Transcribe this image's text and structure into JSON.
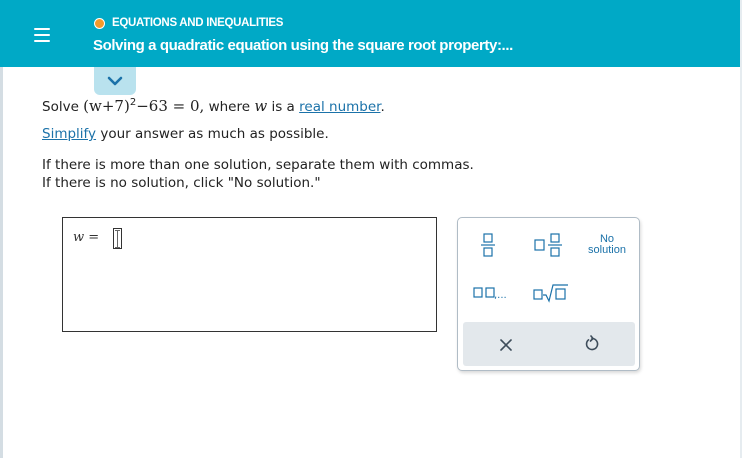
{
  "header": {
    "topic": "EQUATIONS AND INEQUALITIES",
    "title": "Solving a quadratic equation using the square root property:..."
  },
  "problem": {
    "solve_word": "Solve",
    "eq_lhs": "(w+7)",
    "eq_exp": "2",
    "eq_rhs": "−63 = 0,",
    "where_text": "where",
    "var": "w",
    "is_a": "is a",
    "real_number_link": "real number",
    "period": ".",
    "simplify_link": "Simplify",
    "simplify_rest": " your answer as much as possible.",
    "instruction_1": "If there is more than one solution, separate them with commas.",
    "instruction_2": "If there is no solution, click \"No solution.\""
  },
  "answer": {
    "variable": "w",
    "equals": "=",
    "value": ""
  },
  "keypad": {
    "no_solution_line1": "No",
    "no_solution_line2": "solution",
    "list_key_dots": ",..."
  },
  "colors": {
    "header": "#00a9c6",
    "accent_dot": "#f39a2b",
    "link": "#1b72a9",
    "key_blue": "#1b72a9",
    "panel_gray": "#e3e8ec"
  }
}
